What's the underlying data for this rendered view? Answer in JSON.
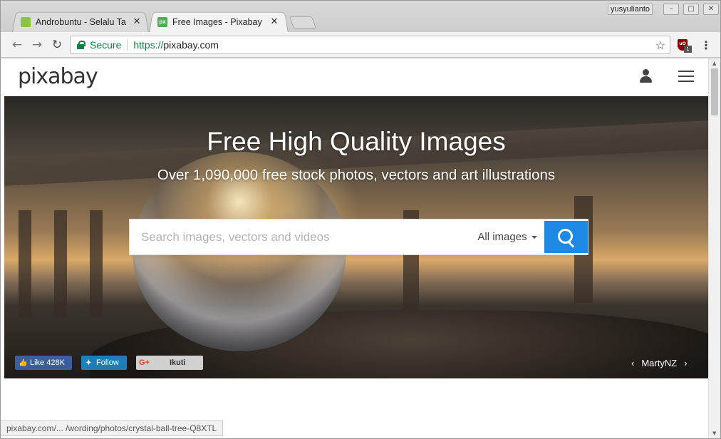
{
  "browser": {
    "tabs": [
      {
        "title": "Androbuntu - Selalu Ta",
        "close": "✕",
        "favicon_color": "#8bc34a"
      },
      {
        "title": "Free Images - Pixabay",
        "close": "✕",
        "favicon_color": "#4caf50",
        "favicon_text": "px"
      }
    ],
    "user_badge": "yusyulianto",
    "window_buttons": [
      "–",
      "□",
      "✕"
    ],
    "nav": {
      "back": "←",
      "forward": "→",
      "reload": "↻"
    },
    "omnibox": {
      "secure_label": "Secure",
      "scheme": "https://",
      "host": "pixabay.com"
    },
    "extension_count": "1",
    "bookmark_icon": "☆",
    "menu_icon": "⋮"
  },
  "pixabay": {
    "logo": "pixabay",
    "hero": {
      "title": "Free High Quality Images",
      "subtitle": "Over 1,090,000 free stock photos, vectors and art illustrations"
    },
    "search": {
      "placeholder": "Search images, vectors and videos",
      "type_selected": "All images"
    },
    "social": {
      "facebook": "Like 428K",
      "twitter": "Follow",
      "gplus": "Ikuti"
    },
    "credit": {
      "prev": "‹",
      "author": "MartyNZ",
      "next": "›"
    }
  },
  "status_bar": "pixabay.com/... /wording/photos/crystal-ball-tree-Q8XTL"
}
